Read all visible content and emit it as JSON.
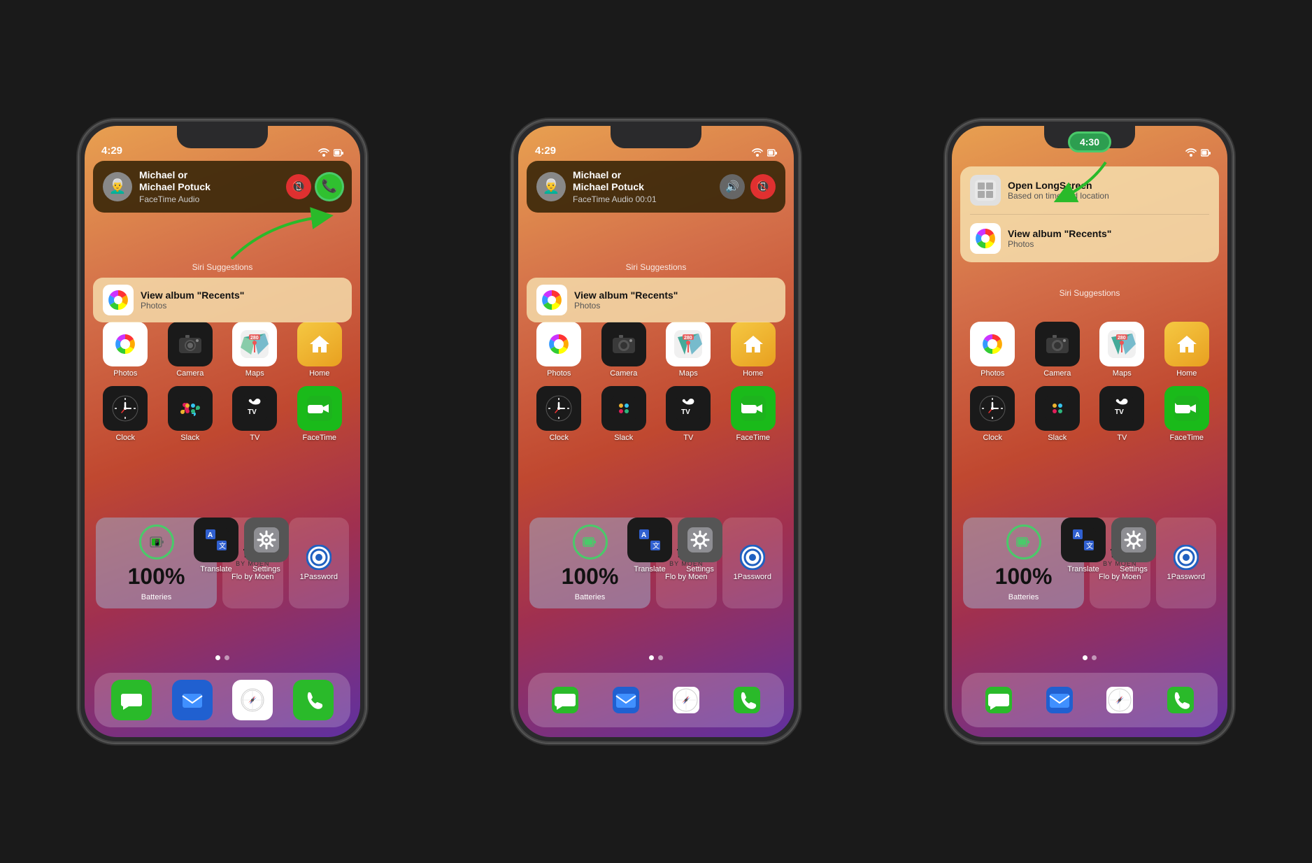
{
  "phones": [
    {
      "id": "phone1",
      "time": "4:29",
      "call": {
        "name": "Michael or\nMichael Potuck",
        "sub": "FaceTime Audio",
        "buttons": [
          "end",
          "accept"
        ],
        "highlight_accept": true
      },
      "siri": {
        "show": true,
        "card": {
          "title": "View album \"Recents\"",
          "sub": "Photos"
        }
      },
      "annotation": "green_arrow_up",
      "has_green_pill": false
    },
    {
      "id": "phone2",
      "time": "4:29",
      "call": {
        "name": "Michael or\nMichael Potuck",
        "sub": "FaceTime Audio 00:01",
        "buttons": [
          "mute",
          "end"
        ],
        "highlight_accept": false
      },
      "siri": {
        "show": true,
        "card": {
          "title": "View album \"Recents\"",
          "sub": "Photos"
        }
      },
      "annotation": null,
      "has_green_pill": false
    },
    {
      "id": "phone3",
      "time": "4:30",
      "call": null,
      "siri": {
        "show": true,
        "double_card": [
          {
            "title": "Open LongScreen",
            "sub": "Based on time and location",
            "icon": "app"
          },
          {
            "title": "View album \"Recents\"",
            "sub": "Photos",
            "icon": "photos"
          }
        ]
      },
      "annotation": "green_arrow_down",
      "has_green_pill": true
    }
  ],
  "apps_row1": [
    {
      "name": "Photos",
      "icon": "photos"
    },
    {
      "name": "Camera",
      "icon": "camera"
    },
    {
      "name": "Maps",
      "icon": "maps"
    },
    {
      "name": "Home",
      "icon": "home"
    }
  ],
  "apps_row2": [
    {
      "name": "Clock",
      "icon": "clock"
    },
    {
      "name": "Slack",
      "icon": "slack"
    },
    {
      "name": "TV",
      "icon": "appletv"
    },
    {
      "name": "FaceTime",
      "icon": "facetime"
    }
  ],
  "apps_row3_right": [
    {
      "name": "Translate",
      "icon": "translate"
    },
    {
      "name": "Settings",
      "icon": "settings"
    }
  ],
  "battery_widget": {
    "percentage": "100%",
    "label": "Batteries"
  },
  "bottom_row": [
    {
      "name": "Flo by Moen",
      "icon": "flo"
    },
    {
      "name": "1Password",
      "icon": "onepass"
    }
  ],
  "dock": [
    {
      "name": "Messages",
      "icon": "messages"
    },
    {
      "name": "Mail",
      "icon": "mail"
    },
    {
      "name": "Safari",
      "icon": "safari"
    },
    {
      "name": "Phone",
      "icon": "phone"
    }
  ],
  "siri_label": "Siri Suggestions",
  "page_dots": [
    true,
    false
  ]
}
